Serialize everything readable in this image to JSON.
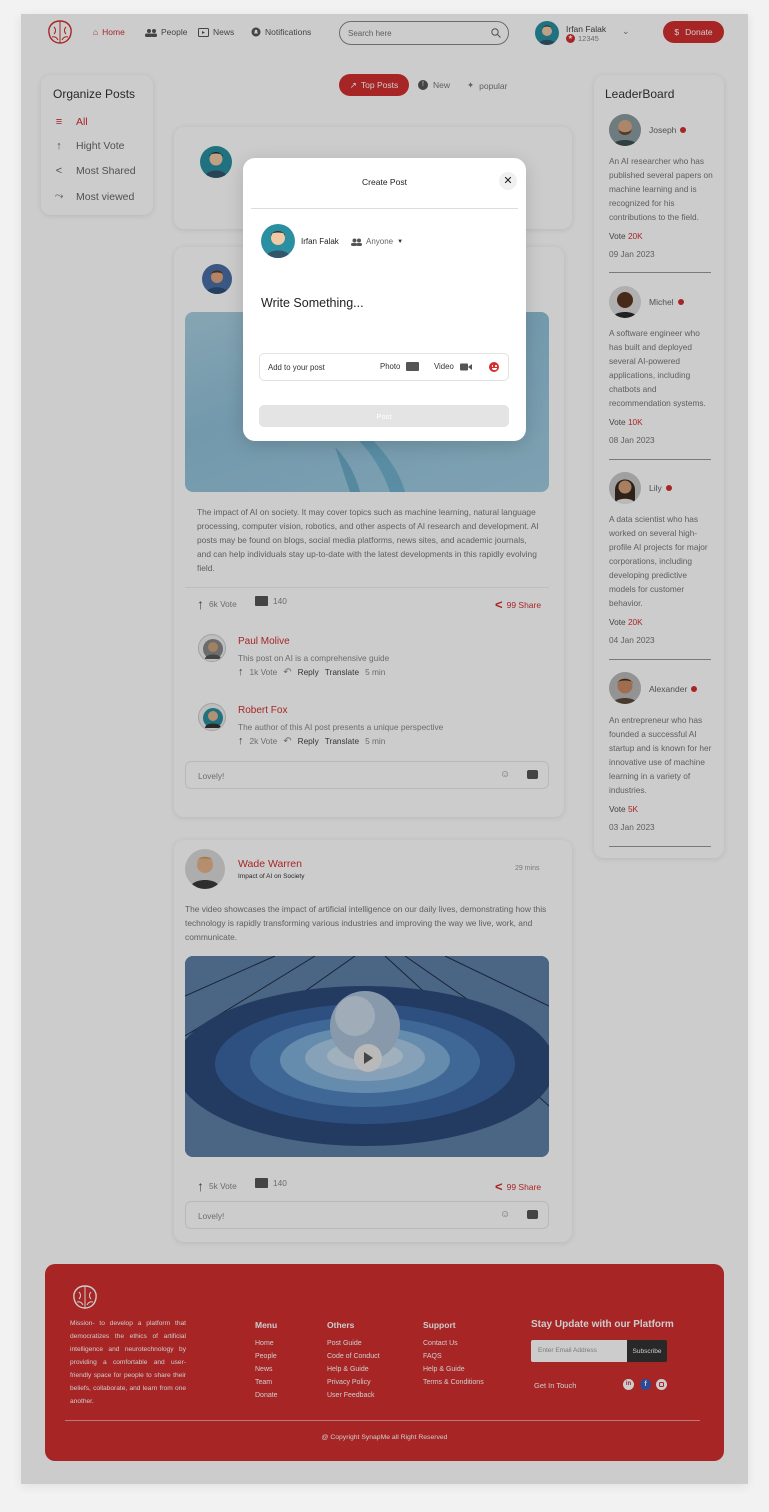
{
  "nav": {
    "home": "Home",
    "people": "People",
    "news": "News",
    "notifications": "Notifications",
    "search_placeholder": "Search here",
    "user_name": "Irfan Falak",
    "user_points": "12345",
    "donate": "Donate"
  },
  "sidebar": {
    "title": "Organize Posts",
    "items": [
      {
        "label": "All",
        "icon": "list-icon"
      },
      {
        "label": "Hight Vote",
        "icon": "arrow-up-icon"
      },
      {
        "label": "Most Shared",
        "icon": "share-icon"
      },
      {
        "label": "Most viewed",
        "icon": "trend-icon"
      }
    ]
  },
  "filters": {
    "top_posts": "Top Posts",
    "new": "New",
    "popular": "popular"
  },
  "post1": {
    "body": "The impact of AI on society. It may cover topics such as machine learning, natural language processing, computer vision, robotics, and other aspects of AI research and development. AI posts may be found on blogs, social media platforms, news sites, and academic journals, and can help individuals stay up-to-date with the latest developments in this rapidly evolving field.",
    "votes": "6k Vote",
    "comments": "140",
    "share": "99 Share",
    "comment_list": [
      {
        "name": "Paul Molive",
        "text": "This post on AI is a comprehensive guide",
        "votes": "1k Vote",
        "reply": "Reply",
        "translate": "Translate",
        "time": "5 min"
      },
      {
        "name": "Robert Fox",
        "text": "The author of this AI post presents a unique perspective",
        "votes": "2k Vote",
        "reply": "Reply",
        "translate": "Translate",
        "time": "5 min"
      }
    ],
    "comment_input": "Lovely!"
  },
  "post2": {
    "author": "Wade Warren",
    "subtitle": "Impact of AI on Society",
    "time": "29 mins",
    "body": "The video showcases the impact of artificial intelligence on our daily lives, demonstrating how this technology is rapidly transforming various industries and improving the way we live, work, and communicate.",
    "votes": "5k Vote",
    "comments": "140",
    "share": "99 Share",
    "comment_input": "Lovely!"
  },
  "leaderboard": {
    "title": "LeaderBoard",
    "entries": [
      {
        "name": "Joseph",
        "text": "An AI researcher who has published several papers on machine learning and is recognized for his contributions to the field.",
        "vote_label": "Vote",
        "vote": "20K",
        "date": "09 Jan 2023"
      },
      {
        "name": "Michel",
        "text": "A software engineer who has built and deployed several AI-powered applications, including chatbots and recommendation systems.",
        "vote_label": "Vote",
        "vote": "10K",
        "date": "08 Jan 2023"
      },
      {
        "name": "Lily",
        "text": "A data scientist who has worked on several high-profile AI projects for major corporations, including developing predictive models for customer behavior.",
        "vote_label": "Vote",
        "vote": "20K",
        "date": "04 Jan 2023"
      },
      {
        "name": "Alexander",
        "text": "An entrepreneur who has founded a successful AI startup and is known for her innovative use of machine learning in a variety of industries.",
        "vote_label": "Vote",
        "vote": "5K",
        "date": "03 Jan 2023"
      }
    ]
  },
  "modal": {
    "title": "Create Post",
    "user_name": "Irfan Falak",
    "audience": "Anyone",
    "placeholder": "Write Something...",
    "add_label": "Add to your post",
    "photo": "Photo",
    "video": "Video",
    "post_button": "Post"
  },
  "footer": {
    "mission": "Mission- to develop a platform that democratizes the ethics of artificial intelligence and neurotechnology by providing a comfortable and user-friendly space for people to share their beliefs, collaborate, and learn from one another.",
    "menu_title": "Menu",
    "menu": [
      "Home",
      "People",
      "News",
      "Team",
      "Donate"
    ],
    "others_title": "Others",
    "others": [
      "Post Guide",
      "Code of Conduct",
      "Help & Guide",
      "Privacy Policy",
      "User Feedback"
    ],
    "support_title": "Support",
    "support": [
      "Contact Us",
      "FAQS",
      "Help & Guide",
      "Terms & Conditions"
    ],
    "stay_title": "Stay Update with our Platform",
    "email_placeholder": "Enter Email Address",
    "subscribe": "Subscribe",
    "get_in_touch": "Get In Touch",
    "copyright": "@ Copyright SynapMe all Right Reserved"
  },
  "colors": {
    "accent": "#d32f2f",
    "overlay": "rgba(0,0,0,0.2)"
  }
}
